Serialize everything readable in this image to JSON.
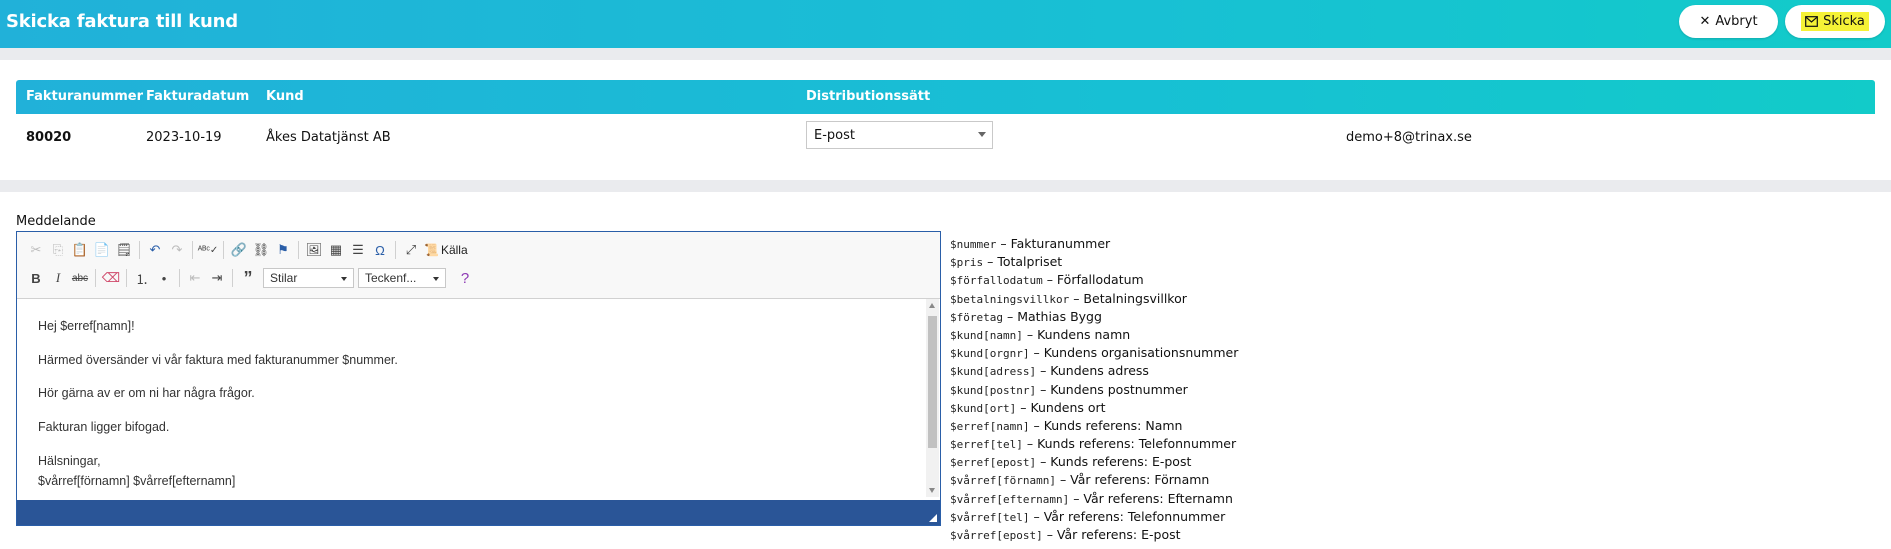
{
  "header": {
    "title": "Skicka faktura till kund",
    "cancel_label": "Avbryt",
    "send_label": "Skicka"
  },
  "invoice_table": {
    "columns": [
      "Fakturanummer",
      "Fakturadatum",
      "Kund",
      "Distributionssätt"
    ],
    "row": {
      "number": "80020",
      "date": "2023-10-19",
      "customer": "Åkes Datatjänst AB",
      "distribution": "E-post",
      "email": "demo+8@trinax.se"
    }
  },
  "message": {
    "label": "Meddelande",
    "toolbar": {
      "source_label": "Källa",
      "styles_label": "Stilar",
      "font_label": "Teckenf..."
    },
    "body_lines": [
      "Hej $erref[namn]!",
      "Härmed översänder vi vår faktura med fakturanummer $nummer.",
      "Hör gärna av er om ni har några frågor.",
      "Fakturan ligger bifogad.",
      "Hälsningar,",
      "$vårref[förnamn] $vårref[efternamn]"
    ]
  },
  "variables": [
    {
      "code": "$nummer",
      "desc": "Fakturanummer"
    },
    {
      "code": "$pris",
      "desc": "Totalpriset"
    },
    {
      "code": "$förfallodatum",
      "desc": "Förfallodatum"
    },
    {
      "code": "$betalningsvillkor",
      "desc": "Betalningsvillkor"
    },
    {
      "code": "$företag",
      "desc": "Mathias Bygg"
    },
    {
      "code": "$kund[namn]",
      "desc": "Kundens namn"
    },
    {
      "code": "$kund[orgnr]",
      "desc": "Kundens organisationsnummer"
    },
    {
      "code": "$kund[adress]",
      "desc": "Kundens adress"
    },
    {
      "code": "$kund[postnr]",
      "desc": "Kundens postnummer"
    },
    {
      "code": "$kund[ort]",
      "desc": "Kundens ort"
    },
    {
      "code": "$erref[namn]",
      "desc": "Kunds referens: Namn"
    },
    {
      "code": "$erref[tel]",
      "desc": "Kunds referens: Telefonnummer"
    },
    {
      "code": "$erref[epost]",
      "desc": "Kunds referens: E-post"
    },
    {
      "code": "$vårref[förnamn]",
      "desc": "Vår referens: Förnamn"
    },
    {
      "code": "$vårref[efternamn]",
      "desc": "Vår referens: Efternamn"
    },
    {
      "code": "$vårref[tel]",
      "desc": "Vår referens: Telefonnummer"
    },
    {
      "code": "$vårref[epost]",
      "desc": "Vår referens: E-post"
    }
  ],
  "colors": {
    "header_gradient_start": "#21b1d9",
    "header_gradient_end": "#12cbc9",
    "editor_status_bar": "#2a5597",
    "send_highlight": "#f5f236"
  }
}
